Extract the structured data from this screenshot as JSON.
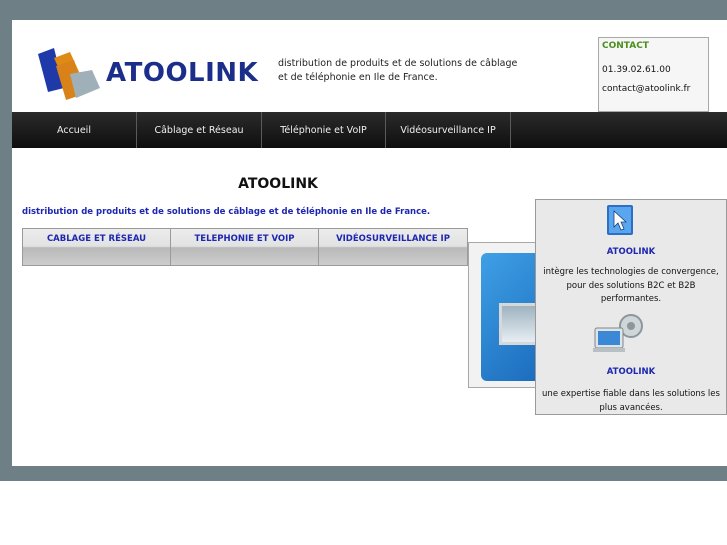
{
  "header": {
    "logo_text": "ATOOLINK",
    "tagline": "distribution de produits et de solutions de câblage et de téléphonie en Ile de France.",
    "contact": {
      "title": "CONTACT",
      "phone": "01.39.02.61.00",
      "email": "contact@atoolink.fr"
    }
  },
  "nav": {
    "items": [
      {
        "label": "Accueil"
      },
      {
        "label": "Câblage et Réseau"
      },
      {
        "label": "Téléphonie et VoIP"
      },
      {
        "label": "Vidéosurveillance IP"
      }
    ]
  },
  "main": {
    "title": "ATOOLINK",
    "intro": "distribution de produits et de solutions de câblage et de téléphonie en Ile de France.",
    "tabs": [
      {
        "label": "CABLAGE ET RÉSEAU"
      },
      {
        "label": "TELEPHONIE ET VOIP"
      },
      {
        "label": "VIDÉOSURVEILLANCE IP"
      }
    ]
  },
  "side": {
    "blocks": [
      {
        "icon": "cursor-window-icon",
        "heading": "ATOOLINK",
        "text": "intègre les technologies de convergence, pour des solutions B2C et B2B performantes."
      },
      {
        "icon": "computer-gear-icon",
        "heading": "ATOOLINK",
        "text": "une expertise fiable dans les solutions les plus avancées."
      }
    ]
  },
  "colors": {
    "brand_blue": "#1b2f8a",
    "link_blue": "#1d27b0",
    "contact_green": "#4a8f1a",
    "nav_dark": "#111111",
    "backdrop": "#6f7f86"
  }
}
